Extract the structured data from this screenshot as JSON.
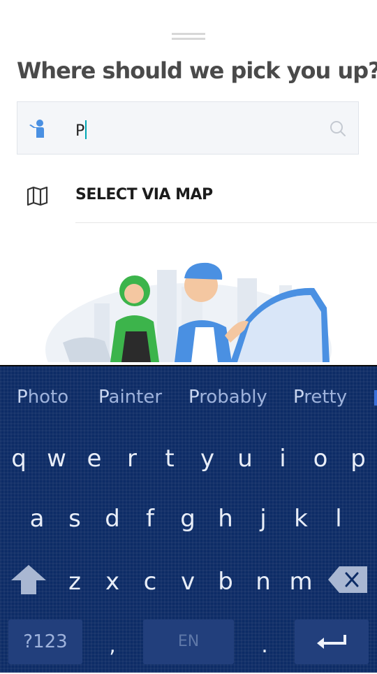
{
  "sheet": {
    "title": "Where should we pick you up?"
  },
  "search": {
    "value": "P",
    "icons": {
      "left": "pickup-person-pin-icon",
      "right": "search-icon"
    },
    "accent_color": "#4a90e2",
    "caret_color": "#00a7b5"
  },
  "map_option": {
    "label": "SELECT VIA MAP",
    "icon": "folded-map-icon"
  },
  "illustration": {
    "description_icon": "driver-and-passenger-illustration"
  },
  "keyboard": {
    "suggestions": [
      "Photo",
      "Painter",
      "Probably",
      "Pretty"
    ],
    "rows": [
      [
        "q",
        "w",
        "e",
        "r",
        "t",
        "y",
        "u",
        "i",
        "o",
        "p"
      ],
      [
        "a",
        "s",
        "d",
        "f",
        "g",
        "h",
        "j",
        "k",
        "l"
      ],
      [
        "z",
        "x",
        "c",
        "v",
        "b",
        "n",
        "m"
      ]
    ],
    "symbols_key": "?123",
    "comma_key": ",",
    "space_key": "EN",
    "period_key": ".",
    "icons": {
      "shift": "shift-arrow-icon",
      "backspace": "backspace-icon",
      "enter": "enter-icon"
    },
    "background_color": "#0d2c66"
  }
}
